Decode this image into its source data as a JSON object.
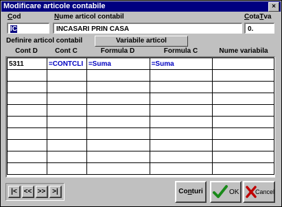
{
  "window": {
    "title": "Modificare articole contabile",
    "close_glyph": "×"
  },
  "labels": {
    "cod_prefix": "C",
    "cod_rest": "od",
    "nume_prefix": "N",
    "nume_rest": "ume articol contabil",
    "cota_prefix": "C",
    "cota_mid": "ota",
    "cota_t": "T",
    "cota_rest": "va",
    "definire": "Definire articol contabil",
    "variabile_button": "Variabile articol"
  },
  "fields": {
    "cod_value": "IC",
    "nume_value": "INCASARI PRIN CASA",
    "cota_value": "0."
  },
  "grid": {
    "headers": [
      "Cont D",
      "Cont C",
      "Formula D",
      "Formula C",
      "Nume variabila"
    ],
    "rows": [
      [
        "5311",
        "=CONTCLI",
        "=Suma",
        "=Suma",
        ""
      ],
      [
        "",
        "",
        "",
        "",
        ""
      ],
      [
        "",
        "",
        "",
        "",
        ""
      ],
      [
        "",
        "",
        "",
        "",
        ""
      ],
      [
        "",
        "",
        "",
        "",
        ""
      ],
      [
        "",
        "",
        "",
        "",
        ""
      ],
      [
        "",
        "",
        "",
        "",
        ""
      ],
      [
        "",
        "",
        "",
        "",
        ""
      ],
      [
        "",
        "",
        "",
        "",
        ""
      ],
      [
        "",
        "",
        "",
        "",
        ""
      ]
    ]
  },
  "nav": {
    "first": "|<",
    "prev": "<<",
    "next": ">>",
    "last": ">|"
  },
  "buttons": {
    "conturi_prefix": "Co",
    "conturi_u": "n",
    "conturi_rest": "turi",
    "ok": "OK",
    "cancel": "Cancel"
  },
  "colors": {
    "title_bar": "#000080",
    "ok_check": "#1a8a1a",
    "cancel_x": "#c00000",
    "link_text": "#0000c0"
  }
}
